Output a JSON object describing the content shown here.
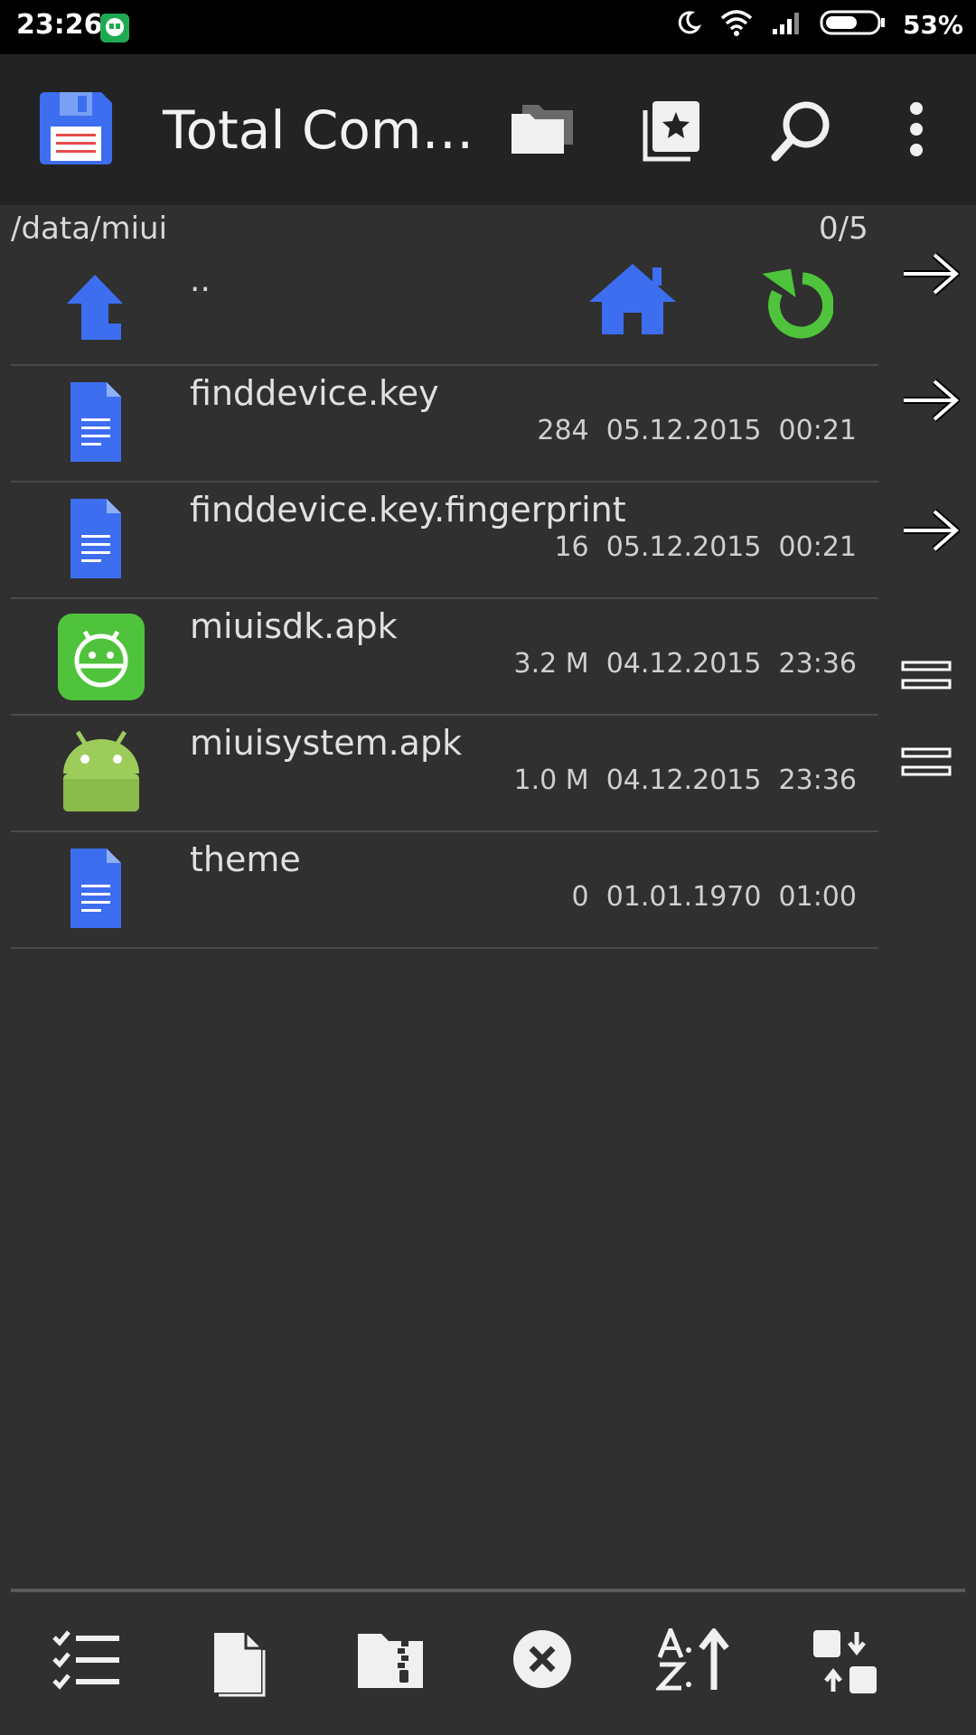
{
  "status_bar": {
    "time": "23:26",
    "battery_percent": "53%",
    "icons": [
      "hangouts-icon",
      "moon-icon",
      "wifi-icon",
      "signal-icon",
      "battery-icon"
    ]
  },
  "app_bar": {
    "title": "Total Com…",
    "icons": [
      "floppy-disk-icon",
      "folders-icon",
      "bookmarks-icon",
      "search-icon",
      "more-vert-icon"
    ]
  },
  "panel": {
    "path": "/data/miui",
    "count": "0/5",
    "up_label": ".."
  },
  "files": [
    {
      "name": "finddevice.key",
      "meta": "284  05.12.2015  00:21",
      "icon": "document-icon"
    },
    {
      "name": "finddevice.key.fingerprint",
      "meta": "16  05.12.2015  00:21",
      "icon": "document-icon"
    },
    {
      "name": "miuisdk.apk",
      "meta": "3.2 M  04.12.2015  23:36",
      "icon": "android-app-icon"
    },
    {
      "name": "miuisystem.apk",
      "meta": "1.0 M  04.12.2015  23:36",
      "icon": "android-icon"
    },
    {
      "name": "theme",
      "meta": "0  01.01.1970  01:00",
      "icon": "document-icon"
    }
  ],
  "side_buttons": [
    "arrow-right-icon",
    "arrow-right-icon",
    "arrow-right-icon",
    "equals-icon",
    "equals-icon"
  ],
  "bottom_toolbar": [
    "select-list-icon",
    "new-file-icon",
    "zip-folder-icon",
    "cancel-icon",
    "sort-az-icon",
    "swap-panels-icon"
  ],
  "colors": {
    "background": "#303030",
    "app_bar": "#232323",
    "accent_blue": "#3d6ef0",
    "accent_green": "#4fc33b",
    "android_green": "#9ccc5a"
  }
}
